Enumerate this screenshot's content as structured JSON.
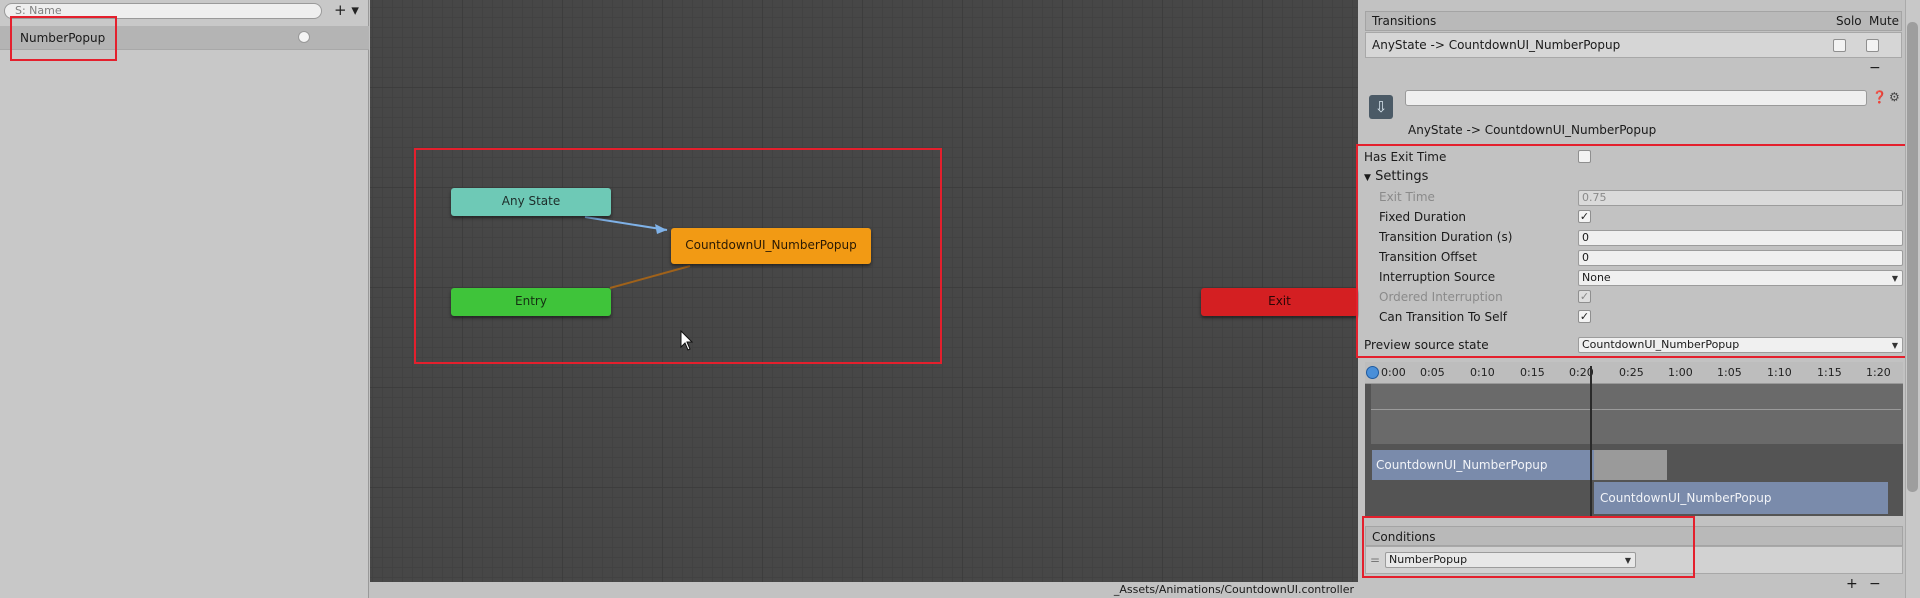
{
  "parameters": {
    "search_placeholder": "S: Name",
    "add_label": "+ ▾",
    "items": [
      {
        "name": "NumberPopup"
      }
    ]
  },
  "graph": {
    "nodes": {
      "any_state": "Any State",
      "entry": "Entry",
      "countdown": "CountdownUI_NumberPopup",
      "exit": "Exit"
    },
    "colors": {
      "any_state": "#6ec9b6",
      "entry": "#3fc43a",
      "countdown": "#f29a14",
      "exit": "#d41f22"
    }
  },
  "status_bar": {
    "path": "_Assets/Animations/CountdownUI.controller"
  },
  "inspector": {
    "transitions_header": "Transitions",
    "solo_label": "Solo",
    "mute_label": "Mute",
    "transition_row": "AnyState -> CountdownUI_NumberPopup",
    "remove_label": "−",
    "title": "AnyState -> CountdownUI_NumberPopup",
    "has_exit_time": {
      "label": "Has Exit Time",
      "checked": false
    },
    "settings_label": "Settings",
    "exit_time": {
      "label": "Exit Time",
      "value": "0.75"
    },
    "fixed_duration": {
      "label": "Fixed Duration",
      "checked": true
    },
    "transition_duration": {
      "label": "Transition Duration (s)",
      "value": "0"
    },
    "transition_offset": {
      "label": "Transition Offset",
      "value": "0"
    },
    "interruption_source": {
      "label": "Interruption Source",
      "value": "None"
    },
    "ordered_interruption": {
      "label": "Ordered Interruption",
      "checked": true
    },
    "can_transition_to_self": {
      "label": "Can Transition To Self",
      "checked": true
    },
    "preview_source_state": {
      "label": "Preview source state",
      "value": "CountdownUI_NumberPopup"
    },
    "timeline": {
      "ticks": [
        "0:00",
        "0:05",
        "0:10",
        "0:15",
        "0:20",
        "0:25",
        "1:00",
        "1:05",
        "1:10",
        "1:15",
        "1:20"
      ],
      "clip1": "CountdownUI_NumberPopup",
      "clip2": "CountdownUI_NumberPopup"
    },
    "conditions_header": "Conditions",
    "condition_value": "NumberPopup",
    "add_label": "+"
  }
}
